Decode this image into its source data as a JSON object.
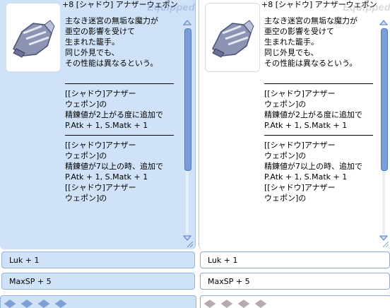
{
  "equipped_watermark": "Equipped",
  "left_panel": {
    "title": "+8 [シャドウ] アナザーウェポン",
    "desc": [
      "主なき迷宮の無垢な魔力が",
      "亜空の影響を受けて",
      "生まれた籠手。",
      "同じ外見でも、",
      "その性能は異なるという。",
      "",
      "---",
      "[[シャドウ]アナザー",
      "ウェポン]の",
      "精錬値が2上がる度に追加で",
      "P.Atk + 1, S.Matk + 1",
      "---",
      "[[シャドウ]アナザー",
      "ウェポン]の",
      "精錬値が7以上の時、追加で",
      "P.Atk + 1, S.Matk + 1",
      "[[シャドウ]アナザー",
      "ウェポン]の"
    ],
    "options": [
      "Luk + 1",
      "MaxSP + 5"
    ]
  },
  "right_panel": {
    "title": "+8 [シャドウ] アナザーウェポン",
    "desc": [
      "主なき迷宮の無垢な魔力が",
      "亜空の影響を受けて",
      "生まれた籠手。",
      "同じ外見でも、",
      "その性能は異なるという。",
      "",
      "---",
      "[[シャドウ]アナザー",
      "ウェポン]の",
      "精錬値が2上がる度に追加で",
      "P.Atk + 1, S.Matk + 1",
      "---",
      "[[シャドウ]アナザー",
      "ウェポン]の",
      "精錬値が7以上の時、追加で",
      "P.Atk + 1, S.Matk + 1",
      "[[シャドウ]アナザー",
      "ウェポン]の"
    ],
    "options": [
      "Luk + 1",
      "MaxSP + 5"
    ]
  },
  "icons": {
    "item": "gauntlet-icon",
    "scroll_up": "arrow-up-icon",
    "scroll_down": "arrow-down-icon",
    "slot": "card-slot-icon"
  },
  "colors": {
    "equipped_bg": "#cfe2f8",
    "scroll_thumb": "#7a9fd8",
    "slot_equipped": "#7c9fd6",
    "slot_plain": "#b9a9b2"
  }
}
